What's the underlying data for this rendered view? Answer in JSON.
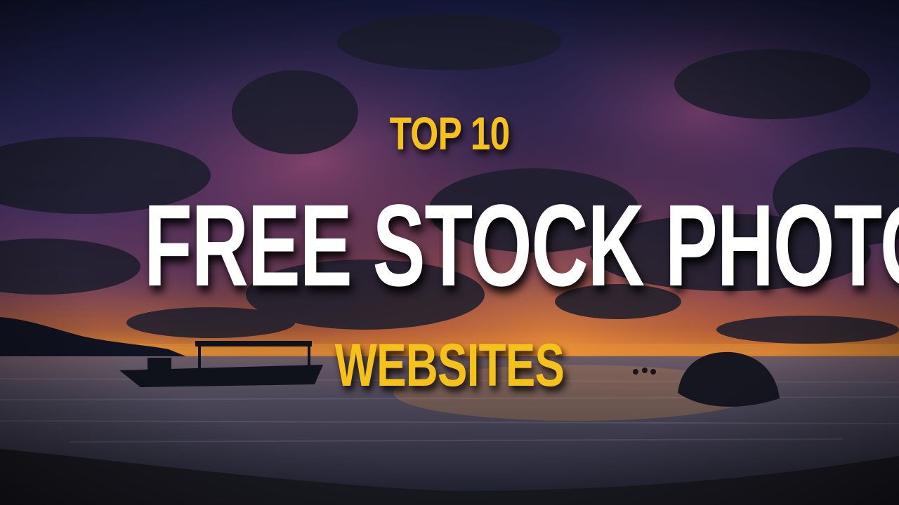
{
  "thumbnail": {
    "line_top": "TOP 10",
    "line_main": "FREE STOCK PHOTO",
    "line_bottom": "WEBSITES"
  },
  "colors": {
    "accent_yellow": "#f6c21a",
    "headline_white": "#ffffff"
  },
  "background": {
    "scene": "sunset-beach-photo"
  }
}
